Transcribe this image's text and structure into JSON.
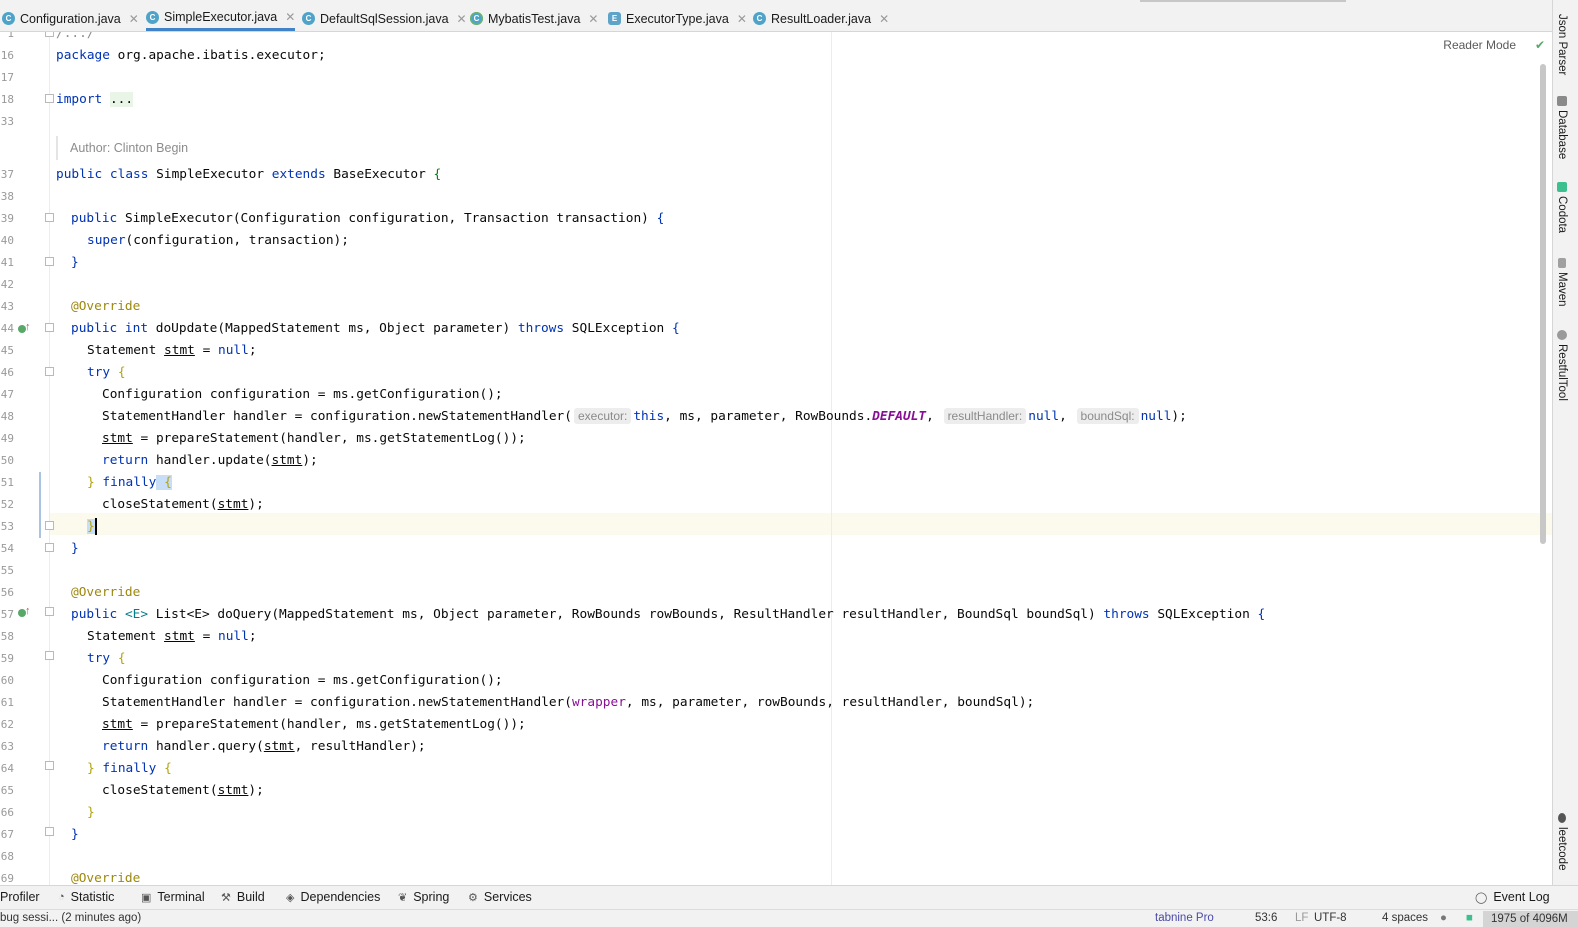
{
  "tabs": [
    {
      "label": "Configuration.java",
      "icon": "C",
      "active": false
    },
    {
      "label": "SimpleExecutor.java",
      "icon": "C",
      "active": true
    },
    {
      "label": "DefaultSqlSession.java",
      "icon": "C",
      "active": false
    },
    {
      "label": "MybatisTest.java",
      "icon": "C",
      "active": false
    },
    {
      "label": "ExecutorType.java",
      "icon": "E",
      "active": false
    },
    {
      "label": "ResultLoader.java",
      "icon": "C",
      "active": false
    }
  ],
  "editor": {
    "reader_mode": "Reader Mode",
    "line_numbers": [
      "1",
      "16",
      "17",
      "18",
      "33",
      "",
      "37",
      "38",
      "39",
      "40",
      "41",
      "42",
      "43",
      "44",
      "45",
      "46",
      "47",
      "48",
      "49",
      "50",
      "51",
      "52",
      "53",
      "54",
      "55",
      "56",
      "57",
      "58",
      "59",
      "60",
      "61",
      "62",
      "63",
      "64",
      "65",
      "66",
      "67",
      "68",
      "69"
    ],
    "author_doc": "Author: Clinton Begin",
    "lines": {
      "l1": "/.../",
      "l16_kw": "package",
      "l16_rest": " org.apache.ibatis.executor;",
      "l18_kw": "import",
      "l18_fold": "...",
      "l37_a": "public class",
      "l37_b": " SimpleExecutor ",
      "l37_c": "extends",
      "l37_d": " BaseExecutor ",
      "l37_e": "{",
      "l39_a": "public",
      "l39_b": " SimpleExecutor",
      "l39_c": "(Configuration configuration, Transaction transaction) ",
      "l39_d": "{",
      "l40_a": "super",
      "l40_b": "(configuration, transaction);",
      "l41": "}",
      "l43": "@Override",
      "l44_a": "public int",
      "l44_b": " doUpdate(MappedStatement ms, Object parameter) ",
      "l44_c": "throws",
      "l44_d": " SQLException ",
      "l44_e": "{",
      "l45_a": "Statement ",
      "l45_b": "stmt",
      "l45_c": " = ",
      "l45_d": "null",
      "l45_e": ";",
      "l46_a": "try",
      "l46_b": " {",
      "l47": "Configuration configuration = ms.getConfiguration();",
      "l48_a": "StatementHandler handler = configuration.newStatementHandler(",
      "l48_h1": "executor:",
      "l48_b": "this",
      "l48_c": ", ms, parameter, RowBounds.",
      "l48_d": "DEFAULT",
      "l48_e": ",",
      "l48_h2": "resultHandler:",
      "l48_f": "null",
      "l48_g": ",",
      "l48_h3": "boundSql:",
      "l48_i": "null",
      "l48_j": ");",
      "l49_a": "stmt",
      "l49_b": " = prepareStatement(handler, ms.getStatementLog());",
      "l50_a": "return",
      "l50_b": " handler.update(",
      "l50_c": "stmt",
      "l50_d": ");",
      "l51_a": "} ",
      "l51_b": "finally",
      "l51_c": " {",
      "l52_a": "closeStatement(",
      "l52_b": "stmt",
      "l52_c": ");",
      "l53": "}",
      "l54": "}",
      "l56": "@Override",
      "l57_a": "public",
      "l57_b": " <E> ",
      "l57_c": "List<E> doQuery(MappedStatement ms, Object parameter, RowBounds rowBounds, ResultHandler resultHandler, BoundSql boundSql) ",
      "l57_d": "throws",
      "l57_e": " SQLException ",
      "l57_f": "{",
      "l58_a": "Statement ",
      "l58_b": "stmt",
      "l58_c": " = ",
      "l58_d": "null",
      "l58_e": ";",
      "l59_a": "try",
      "l59_b": " {",
      "l60": "Configuration configuration = ms.getConfiguration();",
      "l61_a": "StatementHandler handler = configuration.newStatementHandler(",
      "l61_b": "wrapper",
      "l61_c": ", ms, parameter, rowBounds, resultHandler, boundSql);",
      "l62_a": "stmt",
      "l62_b": " = prepareStatement(handler, ms.getStatementLog());",
      "l63_a": "return",
      "l63_b": " handler.query(",
      "l63_c": "stmt",
      "l63_d": ", resultHandler);",
      "l64_a": "} ",
      "l64_b": "finally",
      "l64_c": " {",
      "l65_a": "closeStatement(",
      "l65_b": "stmt",
      "l65_c": ");",
      "l66": "}",
      "l67": "}",
      "l69": "@Override"
    }
  },
  "right_tools": [
    "Json Parser",
    "Database",
    "Codota",
    "Maven",
    "RestfulTool",
    "leetcode"
  ],
  "bottom_tools": {
    "profiler": "Profiler",
    "statistic": "Statistic",
    "terminal": "Terminal",
    "build": "Build",
    "dependencies": "Dependencies",
    "spring": "Spring",
    "services": "Services",
    "event_log": "Event Log"
  },
  "status": {
    "message": "bug sessi... (2 minutes ago)",
    "tabnine": "tabnine Pro",
    "position": "53:6",
    "line_sep": "LF",
    "encoding": "UTF-8",
    "indent": "4 spaces",
    "memory": "1975 of 4096M"
  },
  "colors": {
    "keyword": "#0033b3",
    "annotation": "#9e880d",
    "field": "#871094",
    "active_tab_underline": "#4083c9",
    "current_line": "#fcfaed"
  }
}
